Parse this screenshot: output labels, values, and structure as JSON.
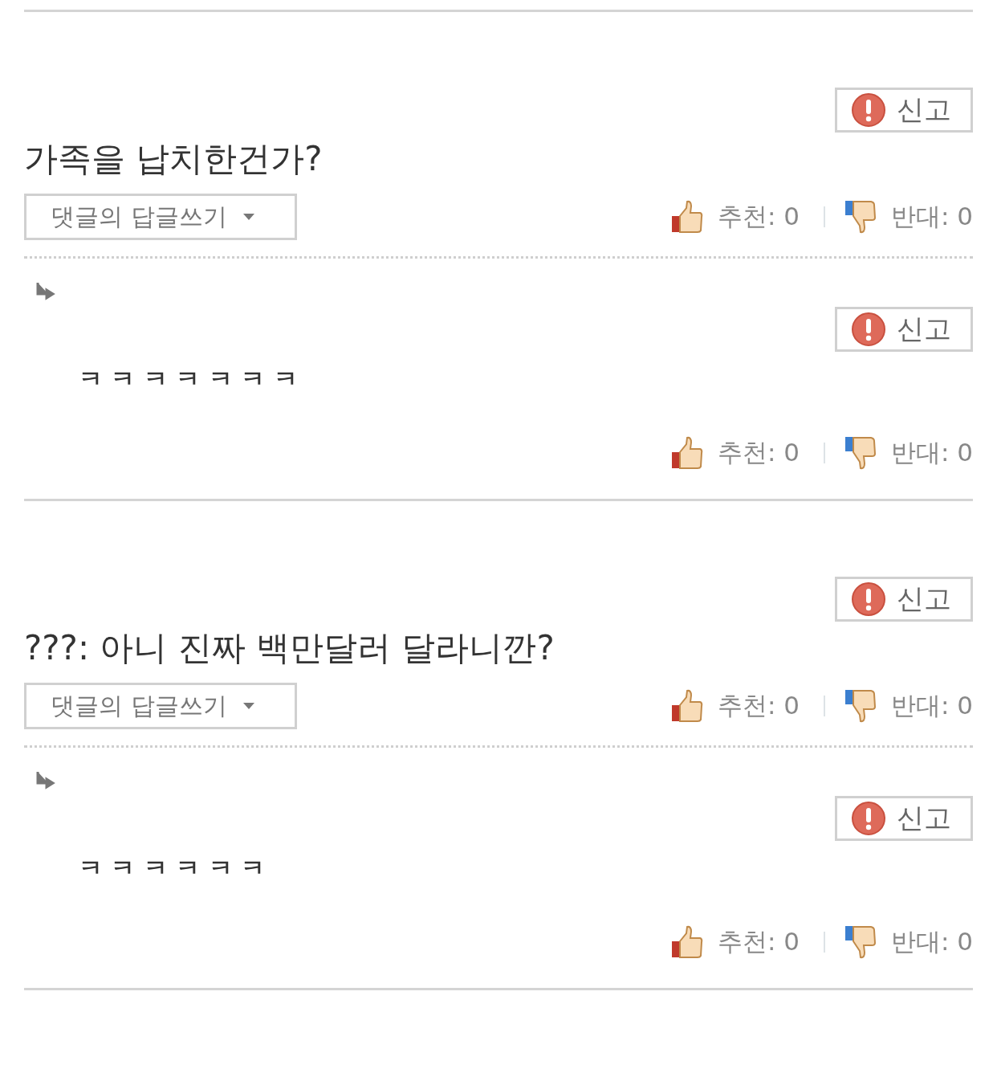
{
  "comments": [
    {
      "text": "가족을 납치한건가?",
      "report": "신고",
      "reply_button": "댓글의 답글쓰기",
      "likes": "추천: 0",
      "dislikes": "반대: 0",
      "replies": [
        {
          "text": "ㅋ ㅋ ㅋ ㅋ ㅋ ㅋ ㅋ",
          "report": "신고",
          "likes": "추천: 0",
          "dislikes": "반대: 0"
        }
      ]
    },
    {
      "text": "???: 아니 진짜 백만달러 달라니깐?",
      "report": "신고",
      "reply_button": "댓글의 답글쓰기",
      "likes": "추천: 0",
      "dislikes": "반대: 0",
      "replies": [
        {
          "text": "ㅋ ㅋ ㅋ ㅋ ㅋ ㅋ",
          "report": "신고",
          "likes": "추천: 0",
          "dislikes": "반대: 0"
        }
      ]
    }
  ]
}
